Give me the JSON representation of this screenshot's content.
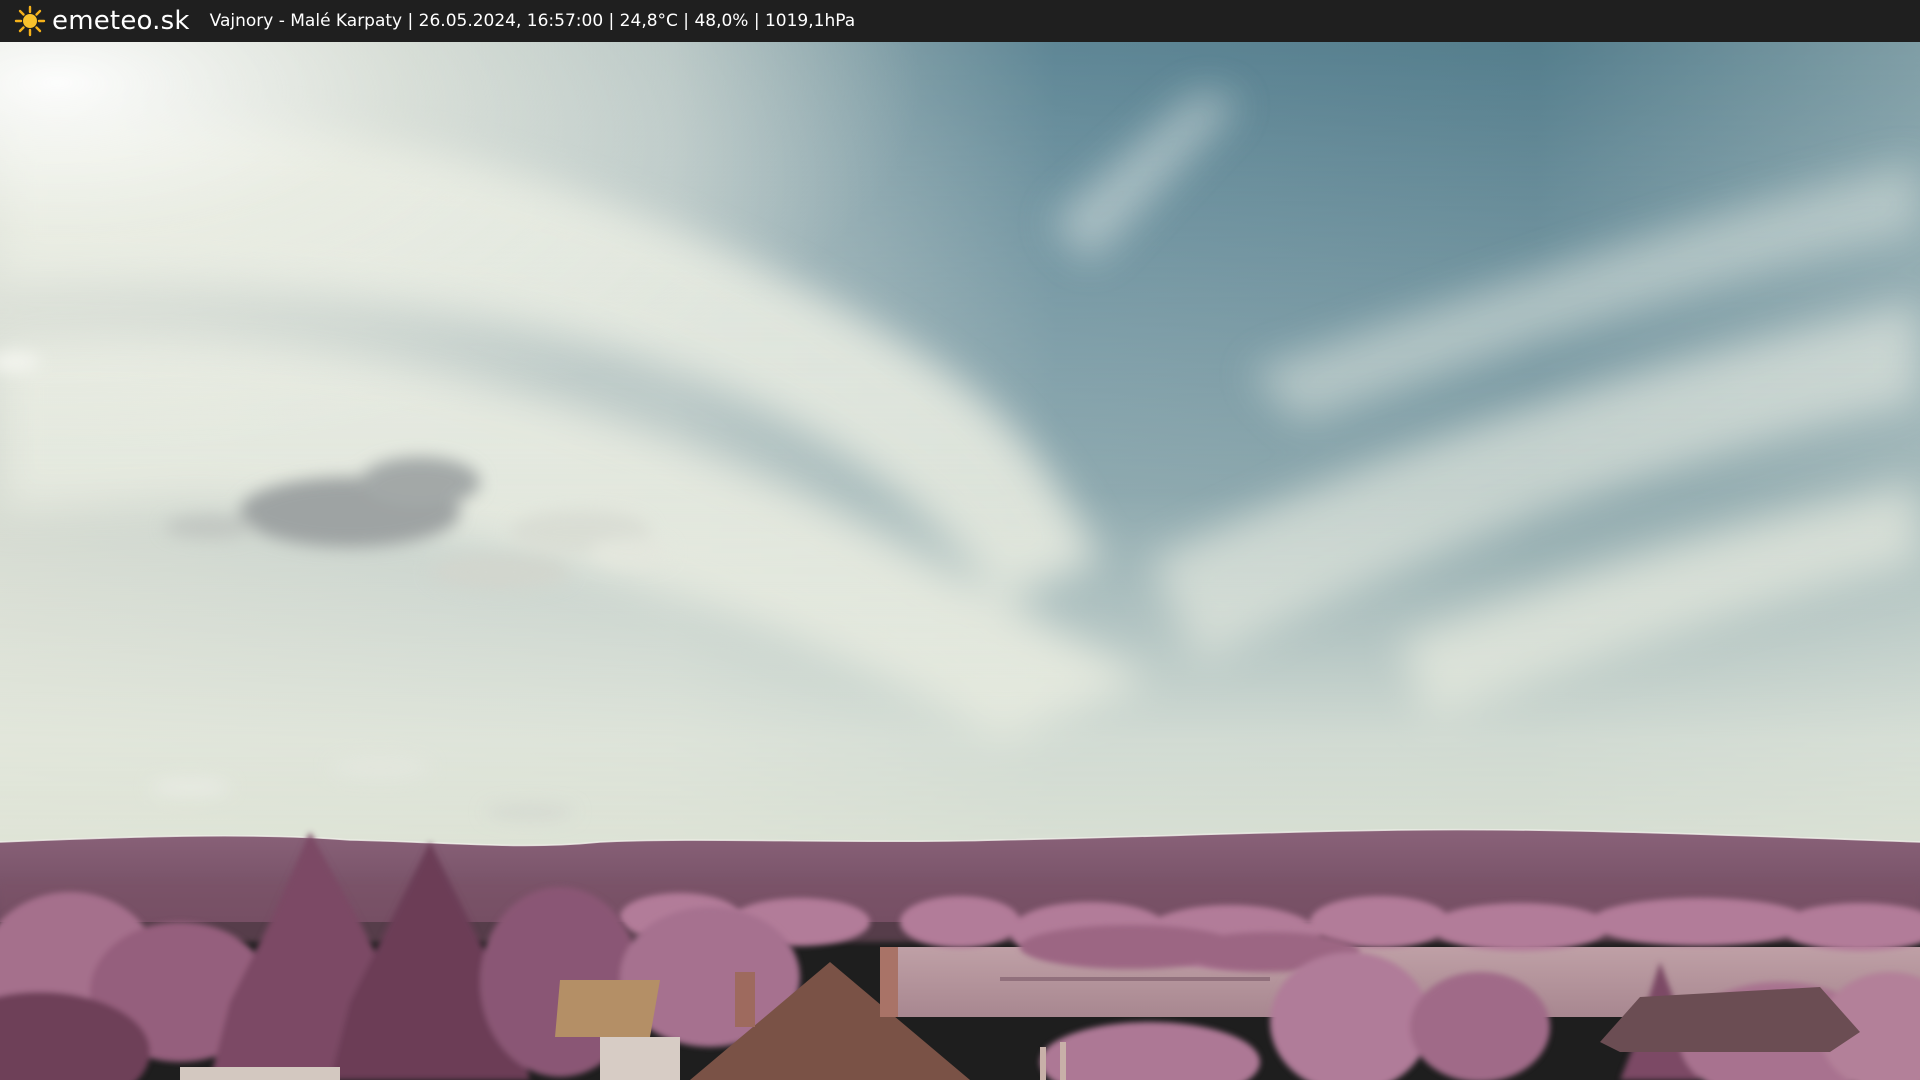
{
  "header": {
    "logo_icon": "sun-icon",
    "brand": "emeteo.sk",
    "caption": "Vajnory - Malé Karpaty | 26.05.2024, 16:57:00 | 24,8°C | 48,0% | 1019,1hPa"
  },
  "webcam": {
    "scene": "infrared landscape webcam image"
  },
  "colors": {
    "bar_background": "#1f1f1f",
    "sky_blue": "#5d8391",
    "cloud_white": "#e6ebe0",
    "hills": "#7a4d68",
    "trees": "#a9708f"
  }
}
